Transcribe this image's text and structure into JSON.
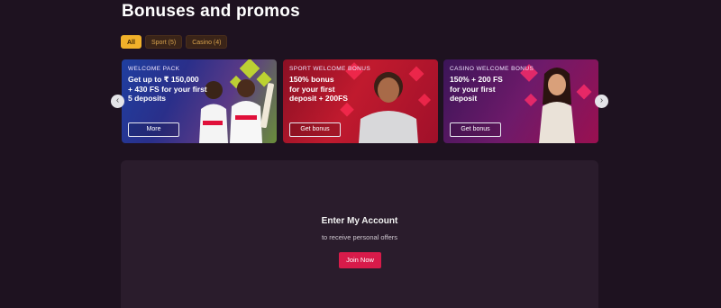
{
  "page": {
    "title": "Bonuses and promos"
  },
  "filters": [
    {
      "label": "All",
      "active": true
    },
    {
      "label": "Sport (5)",
      "active": false
    },
    {
      "label": "Casino (4)",
      "active": false
    }
  ],
  "promos": [
    {
      "tag": "WELCOME PACK",
      "lines": [
        "Get up to ₹ 150,000",
        "+ 430 FS for your first",
        "5 deposits"
      ],
      "button": "More"
    },
    {
      "tag": "SPORT WELCOME BONUS",
      "lines": [
        "150% bonus",
        "for your first",
        "deposit + 200FS"
      ],
      "button": "Get bonus"
    },
    {
      "tag": "CASINO WELCOME BONUS",
      "lines": [
        "150% + 200 FS",
        "for your first",
        "deposit"
      ],
      "button": "Get bonus"
    }
  ],
  "account": {
    "title": "Enter My Account",
    "subtitle": "to receive personal offers",
    "button": "Join Now"
  },
  "icons": {
    "prev": "chevron-left-icon",
    "next": "chevron-right-icon"
  },
  "colors": {
    "background": "#1e1220",
    "accent": "#f1b12a",
    "join": "#d81b4a"
  }
}
